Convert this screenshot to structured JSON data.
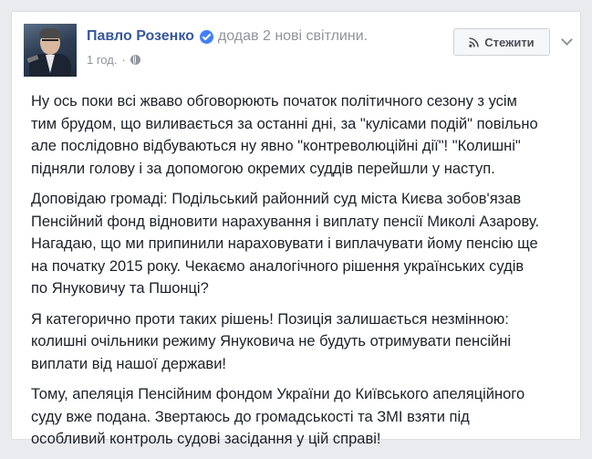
{
  "post": {
    "author": "Павло Розенко",
    "action": "додав 2 нові світлини.",
    "timestamp": "1 год.",
    "follow_label": "Стежити",
    "paragraphs": [
      [
        "Ну ось поки всі жваво обговорюють початок політичного сезону з усім",
        "тим брудом, що виливається за останні дні, за \"кулісами подій\" повільно",
        "але послідовно відбуваються ну явно \"контреволюційні дії\"! \"Колишні\"",
        "підняли голову і за допомогою окремих суддів перейшли у наступ."
      ],
      [
        "Доповідаю громаді: Подільський районний суд міста Києва зобов'язав",
        "Пенсійний фонд відновити нарахування і виплату пенсії Миколі Азарову.",
        "Нагадаю, що ми припинили нараховувати і виплачувати йому пенсію ще",
        "на початку 2015 року. Чекаємо аналогічного рішення українських судів",
        "по Януковичу та Пшонці?"
      ],
      [
        "Я категорично проти таких рішень! Позиція залишається незмінною:",
        "колишні очільники режиму Януковича не будуть отримувати пенсійні",
        "виплати від нашої держави!"
      ],
      [
        "Тому, апеляція Пенсійним фондом України до Київського апеляційного",
        "суду вже подана. Звертаюсь до громадськості та ЗМІ взяти під",
        "особливий контроль судові засідання у цій справі!"
      ]
    ]
  },
  "colors": {
    "author_link": "#365899",
    "secondary_text": "#90949c",
    "body_text": "#1d2129",
    "verified_badge": "#4080ff",
    "page_background": "#e9ebee"
  }
}
